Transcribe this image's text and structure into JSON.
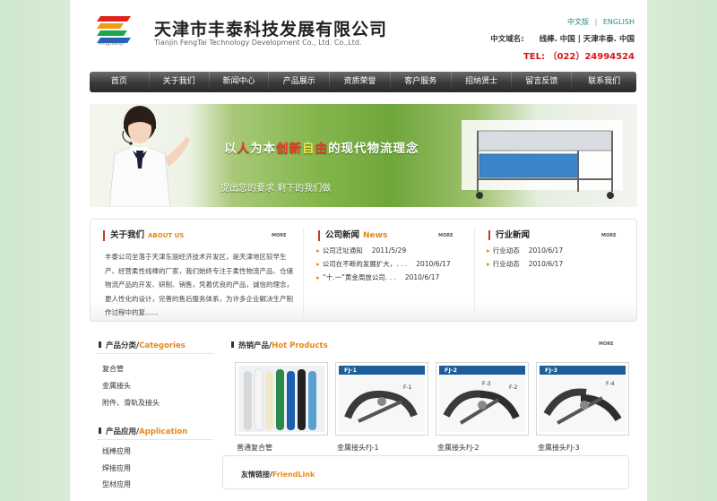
{
  "header": {
    "company_cn": "天津市丰泰科技发展有限公司",
    "company_en": "Tianjin FengTai Technology Development Co., Ltd. Co.,Ltd.",
    "logo_caption": "Fengtaikeji",
    "lang_cn": "中文版",
    "lang_sep": "|",
    "lang_en": "ENGLISH",
    "domain_label": "中文域名:",
    "domain_values": "线棒. 中国 | 天津丰泰. 中国",
    "tel": "TEL: （022）24994524"
  },
  "nav": {
    "items": [
      "首页",
      "关于我们",
      "新闻中心",
      "产品展示",
      "资质荣誉",
      "客户服务",
      "招纳贤士",
      "留言反馈",
      "联系我们"
    ]
  },
  "banner": {
    "slogan_pre": "以",
    "slogan_hl1": "人",
    "slogan_mid": "为本",
    "slogan_hl2": "创新",
    "slogan_mid2": "自",
    "slogan_hl3": "由",
    "slogan_post": "的现代物流理念",
    "sub": "提出您的要求 剩下的我们做"
  },
  "about": {
    "title": "关于我们",
    "title_en": "ABOUT US",
    "more": "MORE",
    "text": "丰泰公司坐落于天津东丽经济技术开发区，是天津地区较早生产、经营柔性线棒的厂家，我们始终专注于柔性物流产品、仓储物流产品的开发、研制、销售，凭着优良的产品，诚信的理念，更人性化的设计，完善的售后服务体系，为许多企业解决生产制作过程中的复……"
  },
  "news": {
    "title": "公司新闻",
    "title_en": "News",
    "more": "MORE",
    "items": [
      {
        "title": "公司迁址通知",
        "date": "2011/5/29"
      },
      {
        "title": "公司在不断的发展扩大，. . .",
        "date": "2010/6/17"
      },
      {
        "title": "“十.一”黄金周放公司. . .",
        "date": "2010/6/17"
      }
    ]
  },
  "industry": {
    "title": "行业新闻",
    "more": "MORE",
    "items": [
      {
        "title": "行业动态",
        "date": "2010/6/17"
      },
      {
        "title": "行业动态",
        "date": "2010/6/17"
      }
    ]
  },
  "sidebar": {
    "cat_title": "产品分类/",
    "cat_title_en": "Categories",
    "cat_items": [
      "复合管",
      "金属接头",
      "附件、滑轨及接头"
    ],
    "app_title": "产品应用/",
    "app_title_en": "Application",
    "app_items": [
      "线棒应用",
      "焊接应用",
      "型材应用"
    ]
  },
  "hot": {
    "title": "热销产品/",
    "title_en": "Hot Products",
    "more": "MORE",
    "products": [
      {
        "name": "普通复合管",
        "tag": ""
      },
      {
        "name": "金属接头FJ-1",
        "tag": "FJ-1"
      },
      {
        "name": "金属接头FJ-2",
        "tag": "FJ-2"
      },
      {
        "name": "金属接头FJ-3",
        "tag": "FJ-3"
      }
    ],
    "part_labels": [
      "F-1",
      "F-3",
      "F-2",
      "F-4"
    ]
  },
  "friend": {
    "title": "友情链接/",
    "title_en": "FriendLink"
  },
  "colors": {
    "accent": "#e48a15",
    "tel": "#d6181a",
    "nav": "#3a3a3a",
    "tag_blue": "#1c5d9a"
  }
}
